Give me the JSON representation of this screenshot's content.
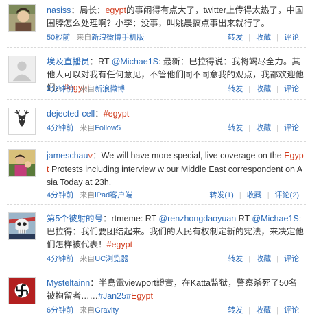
{
  "posts": [
    {
      "name": "nasiss",
      "segments": [
        {
          "t": "：局长：",
          "c": "plain"
        },
        {
          "t": "egypt",
          "c": "red"
        },
        {
          "t": "的事闹得有点大了，twitter上传得太热了，中国围脖怎么处理啊？小李：没事，叫姚晨搞点事出来就行了。",
          "c": "plain"
        }
      ],
      "time": "50秒前",
      "source_prefix": "来自",
      "source": "新浪微博手机版",
      "repost": "转发",
      "favorite": "收藏",
      "comment": "评论",
      "avatar_icon": "photo-avatar-icon"
    },
    {
      "name": "埃及直播员",
      "segments": [
        {
          "t": "：RT ",
          "c": "plain"
        },
        {
          "t": "@Michae1S",
          "c": "link"
        },
        {
          "t": ": 最新：巴拉得说：我将竭尽全力。其他人可以对我有任何意见，不管他们同不同意我的观点，我都欢迎他们。",
          "c": "plain"
        },
        {
          "t": "#egypt",
          "c": "red"
        }
      ],
      "time": "2分钟前",
      "source_prefix": "来自",
      "source": "新浪微博",
      "repost": "转发",
      "favorite": "收藏",
      "comment": "评论",
      "avatar_icon": "default-user-icon"
    },
    {
      "name": "dejected-cell",
      "segments": [
        {
          "t": "：",
          "c": "plain"
        },
        {
          "t": "#egypt",
          "c": "red"
        }
      ],
      "time": "4分钟前",
      "source_prefix": "来自",
      "source": "Follow5",
      "repost": "转发",
      "favorite": "收藏",
      "comment": "评论",
      "avatar_icon": "deer-head-icon"
    },
    {
      "name": "jameschau",
      "verified": "V",
      "segments": [
        {
          "t": "：We will have more special, live coverage on the ",
          "c": "plain"
        },
        {
          "t": "Egypt",
          "c": "red"
        },
        {
          "t": " Protests including interview w our Middle East correspondent on Asia Today at 23h.",
          "c": "plain"
        }
      ],
      "time": "4分钟前",
      "source_prefix": "来自",
      "source": "iPad客户端",
      "repost": "转发(1)",
      "favorite": "收藏",
      "comment": "评论(2)",
      "avatar_icon": "photo-avatar-icon"
    },
    {
      "name": "第5个被射的号",
      "segments": [
        {
          "t": "：rtmeme: RT ",
          "c": "plain"
        },
        {
          "t": "@renzhongdaoyuan",
          "c": "link"
        },
        {
          "t": " RT ",
          "c": "plain"
        },
        {
          "t": "@Michae1S",
          "c": "link"
        },
        {
          "t": ": 巴拉得：我们要团结起来。我们的人民有权制定新的宪法，来决定他们怎样被代表！",
          "c": "plain"
        },
        {
          "t": "#egypt",
          "c": "red"
        }
      ],
      "time": "4分钟前",
      "source_prefix": "来自",
      "source": "UC浏览器",
      "repost": "转发",
      "favorite": "收藏",
      "comment": "评论",
      "avatar_icon": "skull-icon"
    },
    {
      "name": "Mysteltainn",
      "segments": [
        {
          "t": "：半島電viewport證實，在Katta监狱，警察杀死了50名被拘留者……",
          "c": "plain"
        },
        {
          "t": "#Jan25#",
          "c": "link"
        },
        {
          "t": "Egypt",
          "c": "red"
        }
      ],
      "time": "6分钟前",
      "source_prefix": "来自",
      "source": "Gravity",
      "repost": "转发",
      "favorite": "收藏",
      "comment": "评论",
      "avatar_icon": "swastika-flag-icon"
    }
  ]
}
